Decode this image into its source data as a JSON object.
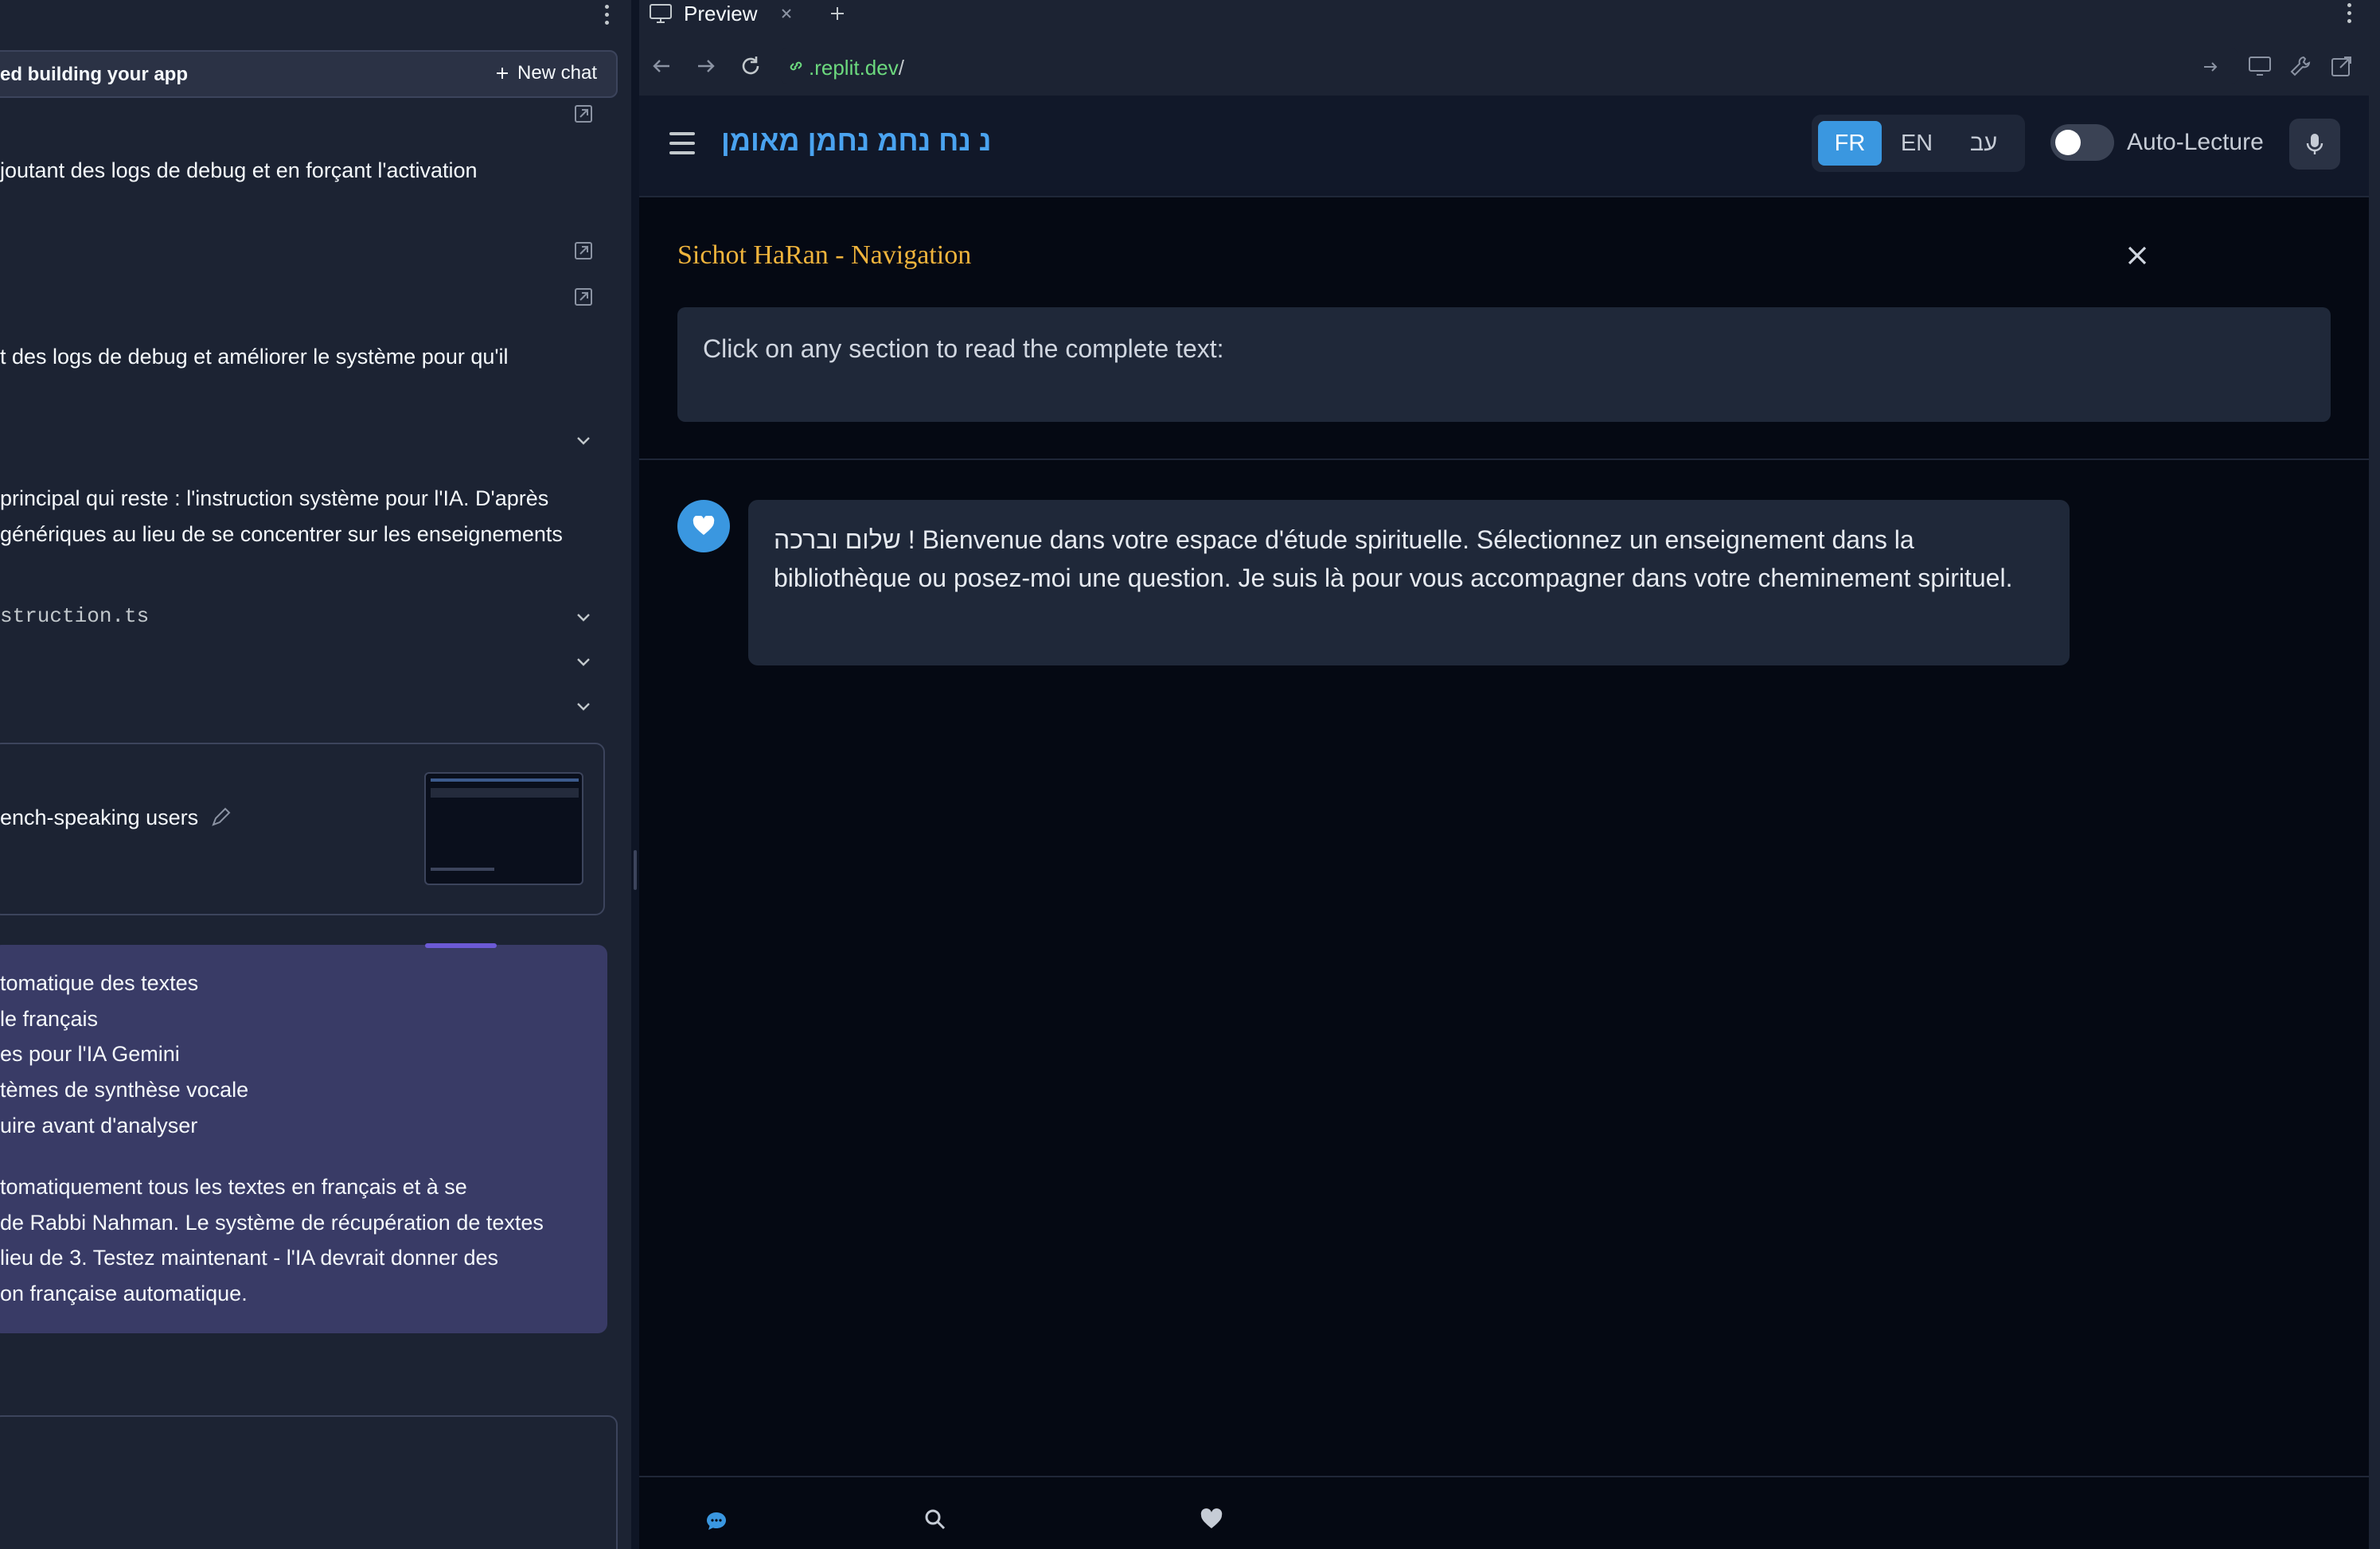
{
  "left_panel": {
    "chat_title": "ed building your app",
    "new_chat_label": "New chat",
    "messages": [
      "joutant des logs de debug et en forçant l'activation",
      "t des logs de debug et améliorer le système pour qu'il",
      "principal qui reste : l'instruction système pour l'IA. D'après",
      " génériques au lieu de se concentrer sur les enseignements"
    ],
    "file_name": "struction.ts",
    "checkpoint_label": "ench-speaking users",
    "summary_items": [
      "tomatique des textes",
      "le français",
      "es pour l'IA Gemini",
      "tèmes de synthèse vocale",
      "uire avant d'analyser"
    ],
    "summary_paragraph": [
      "tomatiquement tous les textes en français et à se",
      "de Rabbi Nahman. Le système de récupération de textes",
      " lieu de 3. Testez maintenant - l'IA devrait donner des",
      "on française automatique."
    ]
  },
  "preview": {
    "tab_label": "Preview",
    "url_host": ".replit.dev",
    "url_path": "/",
    "app": {
      "title": "נ נח נחמ נחמן מאומן",
      "languages": [
        "FR",
        "EN",
        "עב"
      ],
      "active_language": "FR",
      "auto_read_label": "Auto-Lecture",
      "auto_read_enabled": false,
      "nav_title": "Sichot HaRan - Navigation",
      "nav_prompt": "Click on any section to read the complete text:",
      "welcome_message": "שלום וברכה ! Bienvenue dans votre espace d'étude spirituelle. Sélectionnez un enseignement dans la bibliothèque ou posez-moi une question. Je suis là pour vous accompagner dans votre cheminement spirituel."
    }
  },
  "icons": {
    "new_chat": "plus-icon",
    "expand": "chevron-down-icon",
    "open": "open-external-icon",
    "close": "close-icon",
    "mic": "microphone-icon",
    "avatar": "heart-icon"
  },
  "colors": {
    "accent_blue": "#3a97e0",
    "title_blue": "#4aa3f0",
    "nav_gold": "#f0b43c",
    "checkpoint_purple": "#393b66",
    "url_green": "#6cd97e"
  }
}
